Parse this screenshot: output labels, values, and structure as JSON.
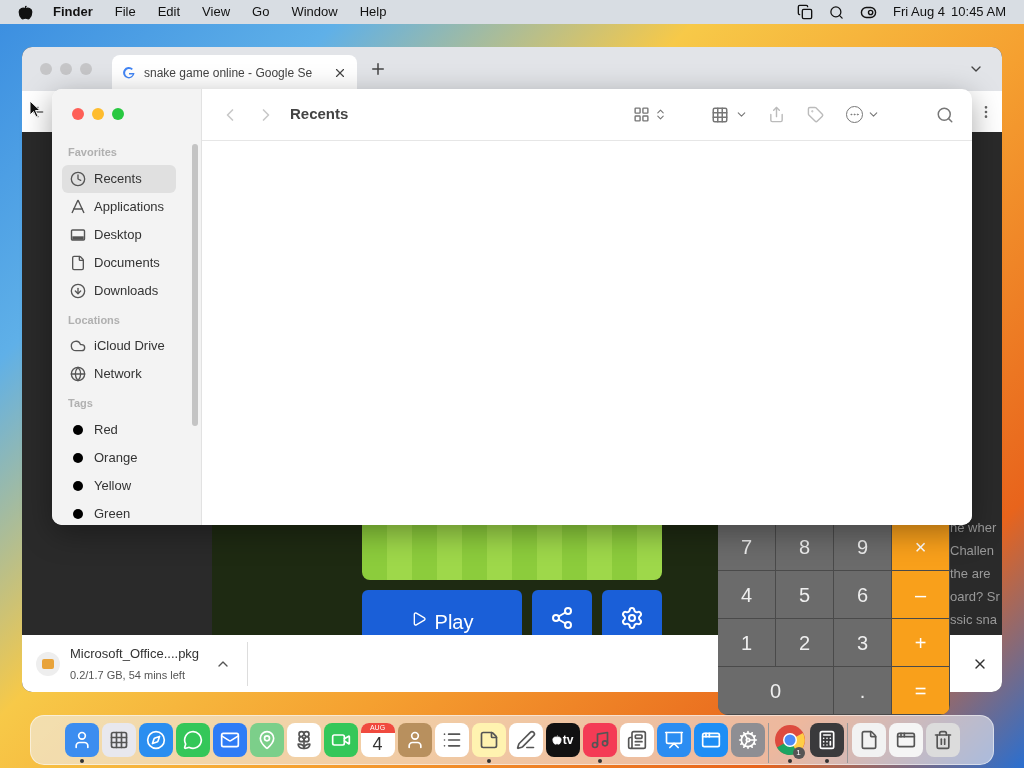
{
  "menubar": {
    "app": "Finder",
    "menus": [
      "File",
      "Edit",
      "View",
      "Go",
      "Window",
      "Help"
    ],
    "date": "Fri Aug 4",
    "time": "10:45 AM"
  },
  "browser": {
    "tab_title": "snake game online - Google Se",
    "play_label": "Play",
    "snippet_lines": [
      "ne wher",
      "Challen",
      "the are",
      "oard? Sr",
      "ssic sna"
    ],
    "download": {
      "file": "Microsoft_Office....pkg",
      "status": "0.2/1.7 GB, 54 mins left"
    }
  },
  "finder": {
    "title": "Recents",
    "sections": [
      {
        "heading": "Favorites",
        "items": [
          {
            "label": "Recents",
            "kind": "clock",
            "selected": true
          },
          {
            "label": "Applications",
            "kind": "apps",
            "selected": false
          },
          {
            "label": "Desktop",
            "kind": "desktop",
            "selected": false
          },
          {
            "label": "Documents",
            "kind": "document",
            "selected": false
          },
          {
            "label": "Downloads",
            "kind": "download",
            "selected": false
          }
        ]
      },
      {
        "heading": "Locations",
        "items": [
          {
            "label": "iCloud Drive",
            "kind": "cloud",
            "selected": false
          },
          {
            "label": "Network",
            "kind": "globe",
            "selected": false
          }
        ]
      },
      {
        "heading": "Tags",
        "items": [
          {
            "label": "Red",
            "kind": "tag",
            "color": "#000000",
            "selected": false
          },
          {
            "label": "Orange",
            "kind": "tag",
            "color": "#000000",
            "selected": false
          },
          {
            "label": "Yellow",
            "kind": "tag",
            "color": "#000000",
            "selected": false
          },
          {
            "label": "Green",
            "kind": "tag",
            "color": "#000000",
            "selected": false
          }
        ]
      }
    ]
  },
  "calculator": {
    "keys": [
      {
        "label": "7",
        "kind": "digit"
      },
      {
        "label": "8",
        "kind": "digit"
      },
      {
        "label": "9",
        "kind": "digit"
      },
      {
        "label": "×",
        "kind": "op"
      },
      {
        "label": "4",
        "kind": "digit"
      },
      {
        "label": "5",
        "kind": "digit"
      },
      {
        "label": "6",
        "kind": "digit"
      },
      {
        "label": "–",
        "kind": "op"
      },
      {
        "label": "1",
        "kind": "digit"
      },
      {
        "label": "2",
        "kind": "digit"
      },
      {
        "label": "3",
        "kind": "digit"
      },
      {
        "label": "+",
        "kind": "op"
      },
      {
        "label": "0",
        "kind": "wide"
      },
      {
        "label": ".",
        "kind": "digit"
      },
      {
        "label": "=",
        "kind": "op"
      }
    ]
  },
  "dock": {
    "items": [
      {
        "kind": "finder",
        "running": true
      },
      {
        "kind": "launchpad",
        "running": false
      },
      {
        "kind": "safari",
        "running": false
      },
      {
        "kind": "messages",
        "running": false
      },
      {
        "kind": "mail",
        "running": false
      },
      {
        "kind": "maps",
        "running": false
      },
      {
        "kind": "photos",
        "running": false
      },
      {
        "kind": "facetime",
        "running": false
      },
      {
        "kind": "calendar",
        "running": false,
        "month": "AUG",
        "day": "4"
      },
      {
        "kind": "contacts",
        "running": false
      },
      {
        "kind": "reminders",
        "running": false
      },
      {
        "kind": "notes",
        "running": true
      },
      {
        "kind": "freeform",
        "running": false
      },
      {
        "kind": "tv",
        "running": false,
        "label": "tv"
      },
      {
        "kind": "music",
        "running": true
      },
      {
        "kind": "news",
        "running": false
      },
      {
        "kind": "keynote",
        "running": false
      },
      {
        "kind": "appstore",
        "running": false
      },
      {
        "kind": "settings",
        "running": false
      },
      {
        "kind": "separator"
      },
      {
        "kind": "chrome",
        "running": true,
        "badge": "1"
      },
      {
        "kind": "calculator",
        "running": true
      },
      {
        "kind": "separator"
      },
      {
        "kind": "document",
        "running": false
      },
      {
        "kind": "window",
        "running": false
      },
      {
        "kind": "trash",
        "running": false
      }
    ]
  }
}
